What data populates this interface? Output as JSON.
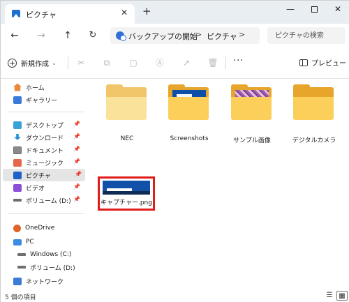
{
  "window": {
    "tab_title": "ピクチャ",
    "close_tab_glyph": "✕",
    "new_tab_glyph": "+",
    "minimize_glyph": "—",
    "close_glyph": "✕"
  },
  "nav": {
    "back_glyph": "←",
    "forward_glyph": "→",
    "up_glyph": "↑",
    "refresh_glyph": "↻",
    "breadcrumb": [
      "バックアップの開始",
      "ピクチャ"
    ],
    "separator": ">",
    "search_placeholder": "ピクチャの検索"
  },
  "commandbar": {
    "new_label": "新規作成",
    "more_glyph": "···",
    "preview_label": "プレビュー"
  },
  "sidebar": {
    "quick": [
      {
        "label": "ホーム",
        "icon": "home-icon"
      },
      {
        "label": "ギャラリー",
        "icon": "gallery-icon"
      }
    ],
    "pinned": [
      {
        "label": "デスクトップ",
        "icon": "desktop-icon"
      },
      {
        "label": "ダウンロード",
        "icon": "download-icon"
      },
      {
        "label": "ドキュメント",
        "icon": "document-icon"
      },
      {
        "label": "ミュージック",
        "icon": "music-icon"
      },
      {
        "label": "ピクチャ",
        "icon": "pictures-icon",
        "selected": true
      },
      {
        "label": "ビデオ",
        "icon": "video-icon"
      },
      {
        "label": "ボリューム (D:)",
        "icon": "drive-icon"
      }
    ],
    "pin_glyph": "📌",
    "locations": [
      {
        "label": "OneDrive",
        "icon": "onedrive-icon"
      },
      {
        "label": "PC",
        "icon": "pc-icon"
      },
      {
        "label": "Windows (C:)",
        "icon": "drive-icon"
      },
      {
        "label": "ボリューム (D:)",
        "icon": "drive-icon"
      },
      {
        "label": "ネットワーク",
        "icon": "network-icon"
      }
    ]
  },
  "content": {
    "folders": [
      {
        "name": "NEC"
      },
      {
        "name": "Screenshots"
      },
      {
        "name": "サンプル画像"
      },
      {
        "name": "デジタルカメラ"
      }
    ],
    "selected_file": {
      "name": "キャプチャー.png"
    }
  },
  "status": {
    "item_count": "5 個の項目"
  },
  "colors": {
    "highlight_border": "#e11a1a",
    "folder": "#fbcf5a",
    "accent": "#1e62c7"
  }
}
